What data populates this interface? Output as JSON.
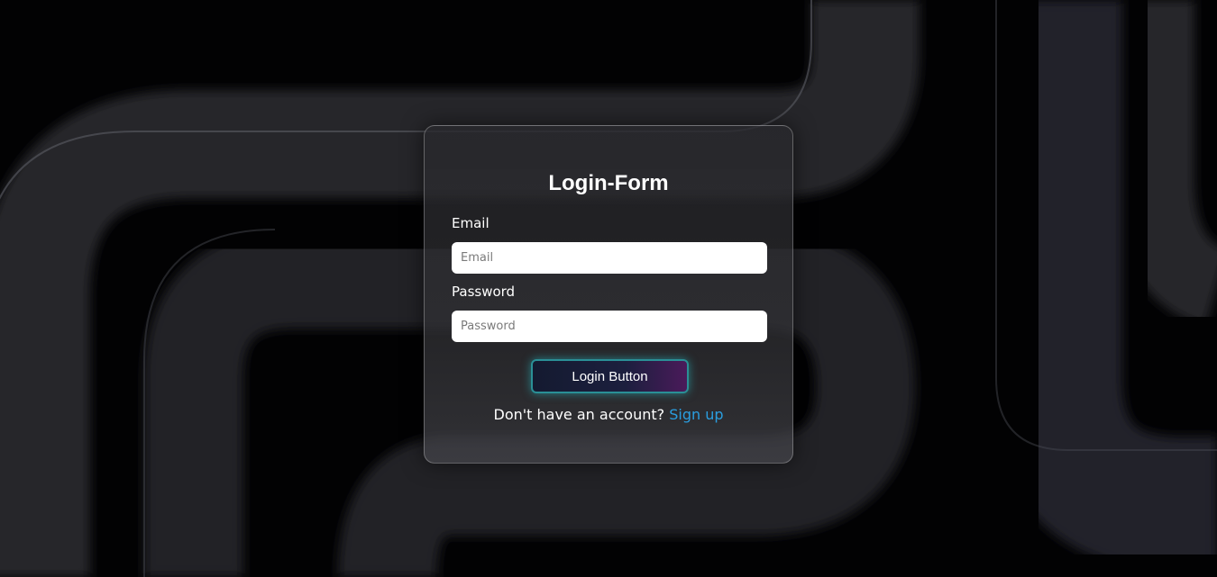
{
  "form": {
    "title": "Login-Form",
    "email_label": "Email",
    "email_placeholder": "Email",
    "email_value": "",
    "password_label": "Password",
    "password_placeholder": "Password",
    "password_value": "",
    "login_button_label": "Login Button",
    "signup_prompt": "Don't have an account?",
    "signup_link_label": "Sign up"
  },
  "colors": {
    "background": "#020203",
    "button_border": "#2a8f96",
    "link": "#2a9ee0"
  }
}
